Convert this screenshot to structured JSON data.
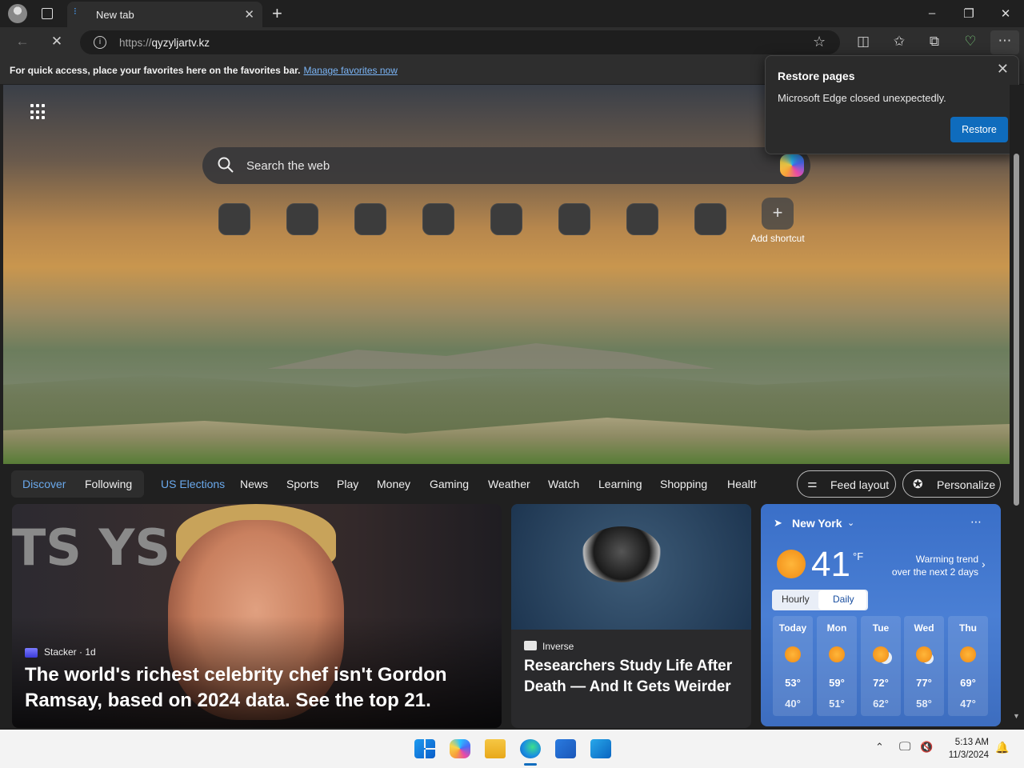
{
  "browser": {
    "tab_title": "New tab",
    "url_protocol": "https://",
    "url_host": "qyzyljartv.kz"
  },
  "favorites_bar": {
    "message": "For quick access, place your favorites here on the favorites bar.",
    "link": "Manage favorites now"
  },
  "search": {
    "placeholder": "Search the web"
  },
  "shortcuts": {
    "add_label": "Add shortcut"
  },
  "restore_popup": {
    "title": "Restore pages",
    "body": "Microsoft Edge closed unexpectedly.",
    "button": "Restore"
  },
  "feed_nav": {
    "discover": "Discover",
    "following": "Following",
    "items": [
      "US Elections",
      "News",
      "Sports",
      "Play",
      "Money",
      "Gaming",
      "Weather",
      "Watch",
      "Learning",
      "Shopping",
      "Health"
    ],
    "feed_layout": "Feed layout",
    "personalize": "Personalize"
  },
  "cards": [
    {
      "source": "Stacker",
      "age": "1d",
      "headline_line1": "The world's richest celebrity chef isn't Gordon",
      "headline_line2": "Ramsay, based on 2024 data. See the top 21.",
      "bg_text": "TS YS"
    },
    {
      "source": "Inverse",
      "headline_line1": "Researchers Study Life After",
      "headline_line2": "Death — And It Gets Weirder"
    }
  ],
  "weather": {
    "location": "New York",
    "temp": "41",
    "unit": "°F",
    "trend_line1": "Warming trend",
    "trend_line2": "over the next 2 days",
    "tab_hourly": "Hourly",
    "tab_daily": "Daily",
    "days": [
      {
        "day": "Today",
        "hi": "53°",
        "lo": "40°",
        "icon": "sunny"
      },
      {
        "day": "Mon",
        "hi": "59°",
        "lo": "51°",
        "icon": "sunny"
      },
      {
        "day": "Tue",
        "hi": "72°",
        "lo": "62°",
        "icon": "partly-cloudy"
      },
      {
        "day": "Wed",
        "hi": "77°",
        "lo": "58°",
        "icon": "partly-cloudy"
      },
      {
        "day": "Thu",
        "hi": "69°",
        "lo": "47°",
        "icon": "sunny"
      }
    ]
  },
  "taskbar": {
    "time": "5:13 AM",
    "date": "11/3/2024"
  },
  "colors": {
    "accent": "#0f6cbd",
    "link": "#7ab4f5",
    "weather_bg": "#3a6fc8"
  }
}
